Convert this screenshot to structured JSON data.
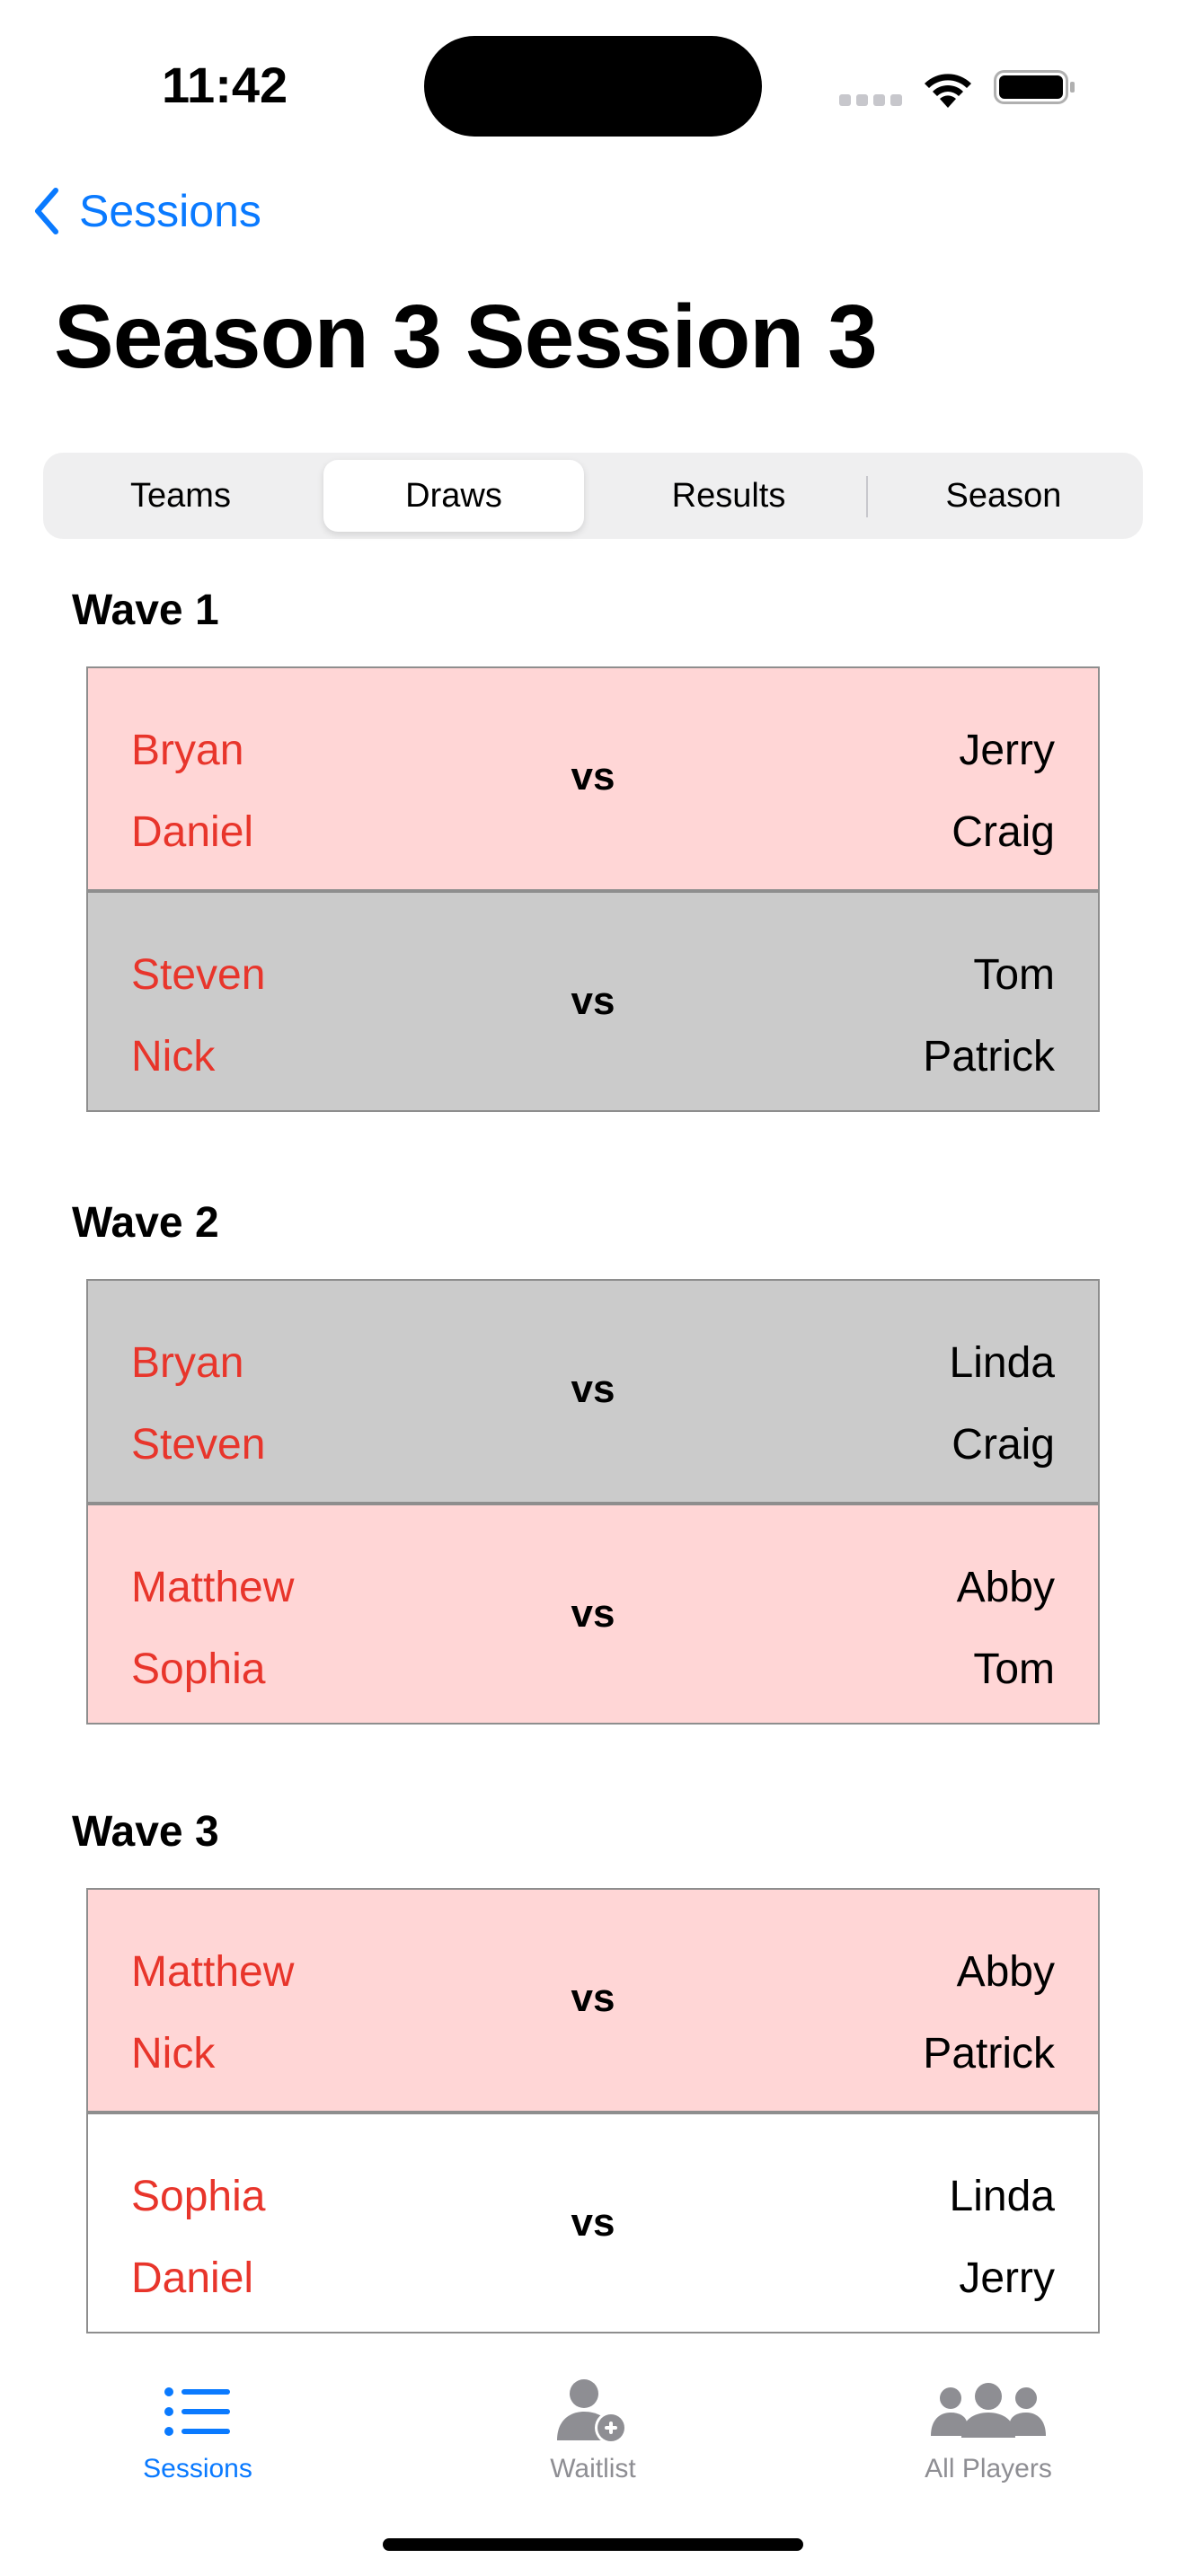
{
  "status_bar": {
    "time": "11:42"
  },
  "nav": {
    "back_label": "Sessions",
    "title": "Season 3 Session 3"
  },
  "segments": [
    {
      "label": "Teams",
      "selected": false
    },
    {
      "label": "Draws",
      "selected": true
    },
    {
      "label": "Results",
      "selected": false
    },
    {
      "label": "Season",
      "selected": false
    }
  ],
  "vs_label": "vs",
  "colors": {
    "accent": "#0a7aff",
    "left_team": "#e8352b",
    "pink_row": "#ffd6d6",
    "gray_row": "#cbcbcb"
  },
  "waves": [
    {
      "title": "Wave 1",
      "matches": [
        {
          "bg": "pink",
          "left": [
            "Bryan",
            "Daniel"
          ],
          "right": [
            "Jerry",
            "Craig"
          ]
        },
        {
          "bg": "gray",
          "left": [
            "Steven",
            "Nick"
          ],
          "right": [
            "Tom",
            "Patrick"
          ]
        }
      ]
    },
    {
      "title": "Wave 2",
      "matches": [
        {
          "bg": "gray",
          "left": [
            "Bryan",
            "Steven"
          ],
          "right": [
            "Linda",
            "Craig"
          ]
        },
        {
          "bg": "pink",
          "left": [
            "Matthew",
            "Sophia"
          ],
          "right": [
            "Abby",
            "Tom"
          ]
        }
      ]
    },
    {
      "title": "Wave 3",
      "matches": [
        {
          "bg": "pink",
          "left": [
            "Matthew",
            "Nick"
          ],
          "right": [
            "Abby",
            "Patrick"
          ]
        },
        {
          "bg": "white",
          "left": [
            "Sophia",
            "Daniel"
          ],
          "right": [
            "Linda",
            "Jerry"
          ]
        }
      ]
    }
  ],
  "tab_bar": [
    {
      "label": "Sessions",
      "icon": "list-bullet-icon",
      "active": true
    },
    {
      "label": "Waitlist",
      "icon": "person-add-icon",
      "active": false
    },
    {
      "label": "All Players",
      "icon": "people-group-icon",
      "active": false
    }
  ]
}
